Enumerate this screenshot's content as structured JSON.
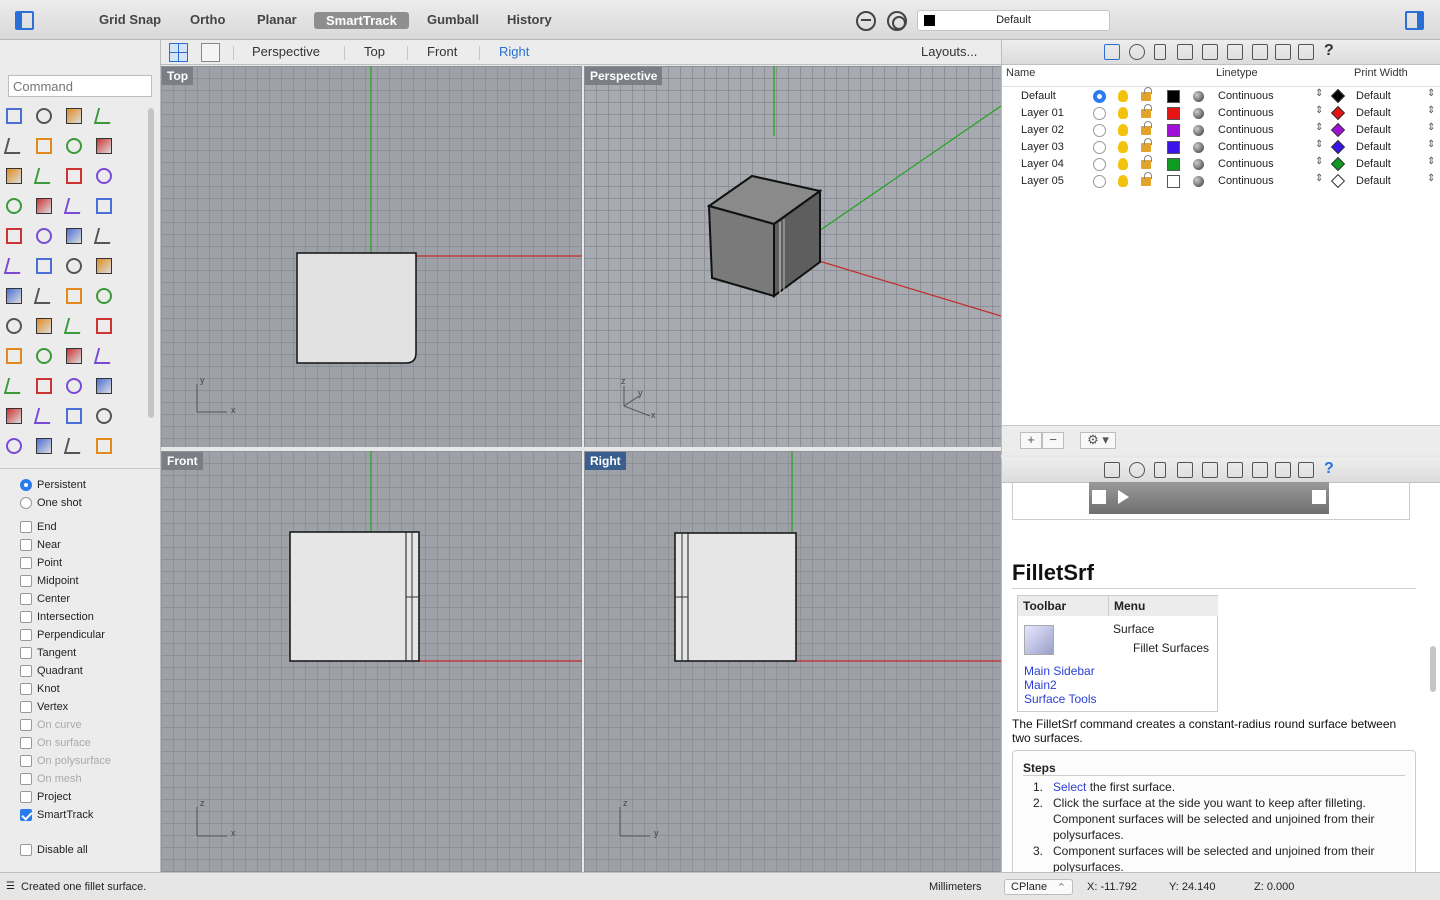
{
  "toolbar": {
    "modes": [
      "Grid Snap",
      "Ortho",
      "Planar",
      "SmartTrack",
      "Gumball",
      "History"
    ],
    "active_mode": "SmartTrack",
    "layer_select": "Default"
  },
  "command": {
    "placeholder": "Command"
  },
  "viewport_tabs": {
    "tabs": [
      "Perspective",
      "Top",
      "Front",
      "Right"
    ],
    "selected": "Right",
    "layouts_label": "Layouts..."
  },
  "viewports": {
    "top": {
      "label": "Top",
      "axis_a": "y",
      "axis_b": "x"
    },
    "perspective": {
      "label": "Perspective",
      "axis_z": "z",
      "axis_y": "y",
      "axis_x": "x"
    },
    "front": {
      "label": "Front",
      "axis_a": "z",
      "axis_b": "x"
    },
    "right": {
      "label": "Right",
      "axis_a": "z",
      "axis_b": "y"
    }
  },
  "osnap": {
    "persistent": "Persistent",
    "one_shot": "One shot",
    "items": [
      {
        "label": "End",
        "checked": false,
        "disabled": false
      },
      {
        "label": "Near",
        "checked": false,
        "disabled": false
      },
      {
        "label": "Point",
        "checked": false,
        "disabled": false
      },
      {
        "label": "Midpoint",
        "checked": false,
        "disabled": false
      },
      {
        "label": "Center",
        "checked": false,
        "disabled": false
      },
      {
        "label": "Intersection",
        "checked": false,
        "disabled": false
      },
      {
        "label": "Perpendicular",
        "checked": false,
        "disabled": false
      },
      {
        "label": "Tangent",
        "checked": false,
        "disabled": false
      },
      {
        "label": "Quadrant",
        "checked": false,
        "disabled": false
      },
      {
        "label": "Knot",
        "checked": false,
        "disabled": false
      },
      {
        "label": "Vertex",
        "checked": false,
        "disabled": false
      },
      {
        "label": "On curve",
        "checked": false,
        "disabled": true
      },
      {
        "label": "On surface",
        "checked": false,
        "disabled": true
      },
      {
        "label": "On polysurface",
        "checked": false,
        "disabled": true
      },
      {
        "label": "On mesh",
        "checked": false,
        "disabled": true
      },
      {
        "label": "Project",
        "checked": false,
        "disabled": false
      },
      {
        "label": "SmartTrack",
        "checked": true,
        "disabled": false
      }
    ],
    "disable_all": "Disable all"
  },
  "layers": {
    "headers": {
      "name": "Name",
      "linetype": "Linetype",
      "print_width": "Print Width"
    },
    "rows": [
      {
        "name": "Default",
        "current": true,
        "color": "#000000",
        "linetype": "Continuous",
        "print_color": "#000000",
        "print_width": "Default"
      },
      {
        "name": "Layer 01",
        "current": false,
        "color": "#e31414",
        "linetype": "Continuous",
        "print_color": "#e31414",
        "print_width": "Default"
      },
      {
        "name": "Layer 02",
        "current": false,
        "color": "#a010d8",
        "linetype": "Continuous",
        "print_color": "#a010d8",
        "print_width": "Default"
      },
      {
        "name": "Layer 03",
        "current": false,
        "color": "#3a14e8",
        "linetype": "Continuous",
        "print_color": "#3a14e8",
        "print_width": "Default"
      },
      {
        "name": "Layer 04",
        "current": false,
        "color": "#0f9a22",
        "linetype": "Continuous",
        "print_color": "#0f9a22",
        "print_width": "Default"
      },
      {
        "name": "Layer 05",
        "current": false,
        "color": "#ffffff",
        "linetype": "Continuous",
        "print_color": "#ffffff",
        "print_width": "Default"
      }
    ]
  },
  "help": {
    "title": "FilletSrf",
    "table": {
      "col_toolbar": "Toolbar",
      "col_menu": "Menu",
      "toolbar_links": [
        "Main Sidebar",
        "Main2",
        "Surface Tools"
      ],
      "menu": "Surface",
      "submenu": "Fillet Surfaces"
    },
    "description": "The FilletSrf command creates a constant-radius round surface between two surfaces.",
    "steps_heading": "Steps",
    "steps": [
      {
        "num": "1.",
        "link": "Select",
        "text": " the first surface."
      },
      {
        "num": "2.",
        "link": "",
        "text": "Click the surface at the side you want to keep after filleting. Component surfaces will be selected and unjoined from their polysurfaces."
      },
      {
        "num": "3.",
        "link": "",
        "text": "Component surfaces will be selected and unjoined from their polysurfaces."
      }
    ]
  },
  "status": {
    "message": "Created one fillet surface.",
    "units": "Millimeters",
    "cplane": "CPlane",
    "x": "X: -11.792",
    "y": "Y: 24.140",
    "z": "Z: 0.000"
  }
}
